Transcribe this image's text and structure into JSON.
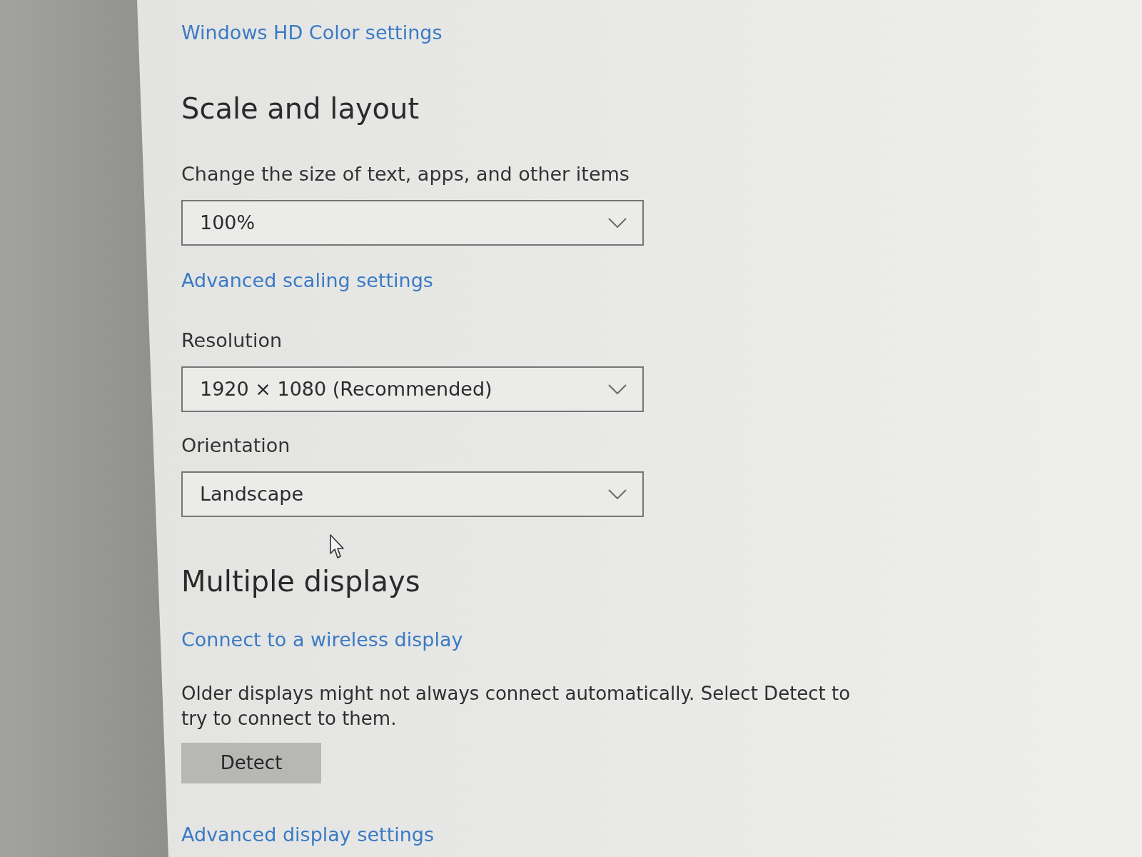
{
  "sections": [
    {
      "items": [
        {
          "kind": "link",
          "text": "Windows HD Color settings"
        }
      ]
    },
    {
      "title": "Scale and layout",
      "items": [
        {
          "kind": "dropdown",
          "label": "Change the size of text, apps, and other items",
          "value": "100%"
        },
        {
          "kind": "link",
          "text": "Advanced scaling settings"
        },
        {
          "kind": "dropdown",
          "label": "Resolution",
          "value": "1920 × 1080 (Recommended)"
        },
        {
          "kind": "dropdown",
          "label": "Orientation",
          "value": "Landscape"
        }
      ]
    },
    {
      "title": "Multiple displays",
      "items": [
        {
          "kind": "link",
          "text": "Connect to a wireless display"
        },
        {
          "kind": "text",
          "text": "Older displays might not always connect automatically. Select Detect to try to connect to them."
        },
        {
          "kind": "button",
          "label": "Detect"
        },
        {
          "kind": "link",
          "text": "Advanced display settings"
        }
      ]
    }
  ]
}
